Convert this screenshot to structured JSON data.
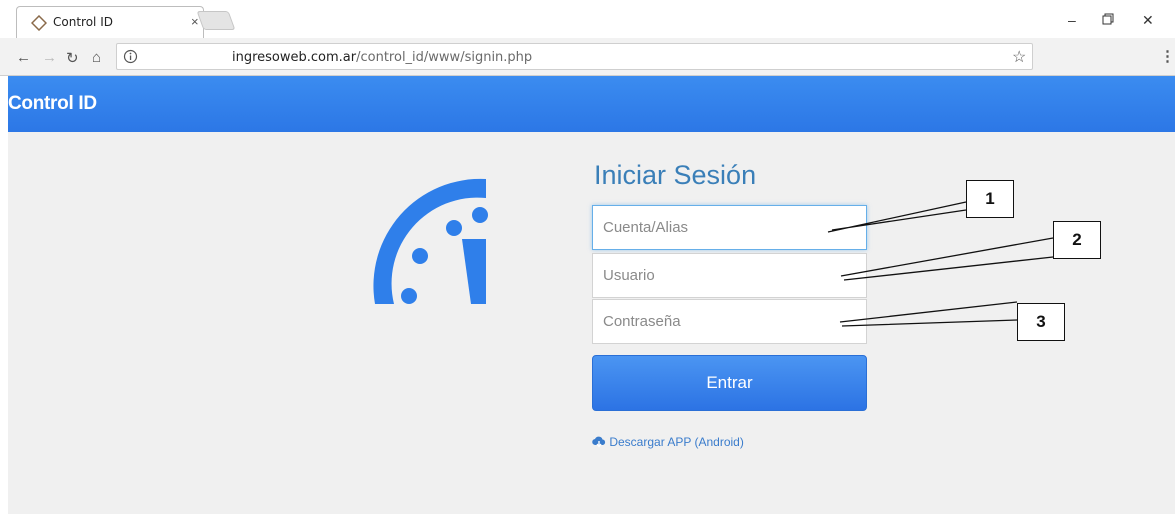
{
  "browser": {
    "tab_title": "Control ID",
    "tab_close": "×",
    "url_host": "ingresoweb.com.ar",
    "url_path": "/control_id/www/signin.php"
  },
  "app": {
    "title": "Control ID",
    "accent_color": "#2f7fea"
  },
  "form": {
    "heading": "Iniciar Sesión",
    "account_placeholder": "Cuenta/Alias",
    "user_placeholder": "Usuario",
    "password_placeholder": "Contraseña",
    "submit_label": "Entrar",
    "download_link": "Descargar APP (Android)"
  },
  "callouts": [
    "1",
    "2",
    "3"
  ],
  "icons": [
    "clock-logo-icon",
    "back-icon",
    "forward-icon",
    "reload-icon",
    "home-icon",
    "info-icon",
    "star-icon",
    "menu-icon",
    "download-icon"
  ]
}
